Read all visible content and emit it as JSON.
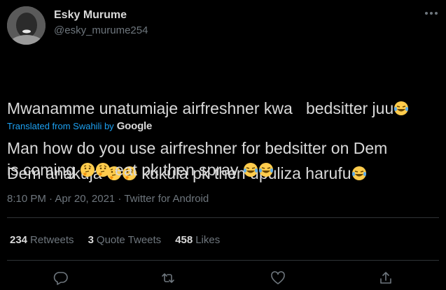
{
  "author": {
    "name": "Esky Murume",
    "handle": "@esky_murume254"
  },
  "tweet": {
    "original_line1": "Mwanamme unatumiaje airfreshner kwa   bedsitter juu",
    "original_line2_a": "Dem anakuja",
    "original_line2_b": "kukula pk then upuliza harufu",
    "translated_by_prefix": "Translated from Swahili by",
    "translated_by_brand": "Google",
    "translation_line1": "Man how do you use airfreshner for bedsitter on Dem",
    "translation_line2_a": "is coming",
    "translation_line2_b": "eat pk then spray",
    "timestamp": "8:10 PM · Apr 20, 2021 · Twitter for Android"
  },
  "stats": {
    "retweets_count": "234",
    "retweets_label": "Retweets",
    "quotes_count": "3",
    "quotes_label": "Quote Tweets",
    "likes_count": "458",
    "likes_label": "Likes"
  },
  "icons": {
    "more": "more-icon",
    "reply": "reply-icon",
    "retweet": "retweet-icon",
    "like": "heart-icon",
    "share": "share-icon"
  },
  "colors": {
    "background": "#000000",
    "text": "#d9d9d9",
    "muted": "#6e767d",
    "link": "#1da1f2",
    "divider": "#2f3336"
  }
}
